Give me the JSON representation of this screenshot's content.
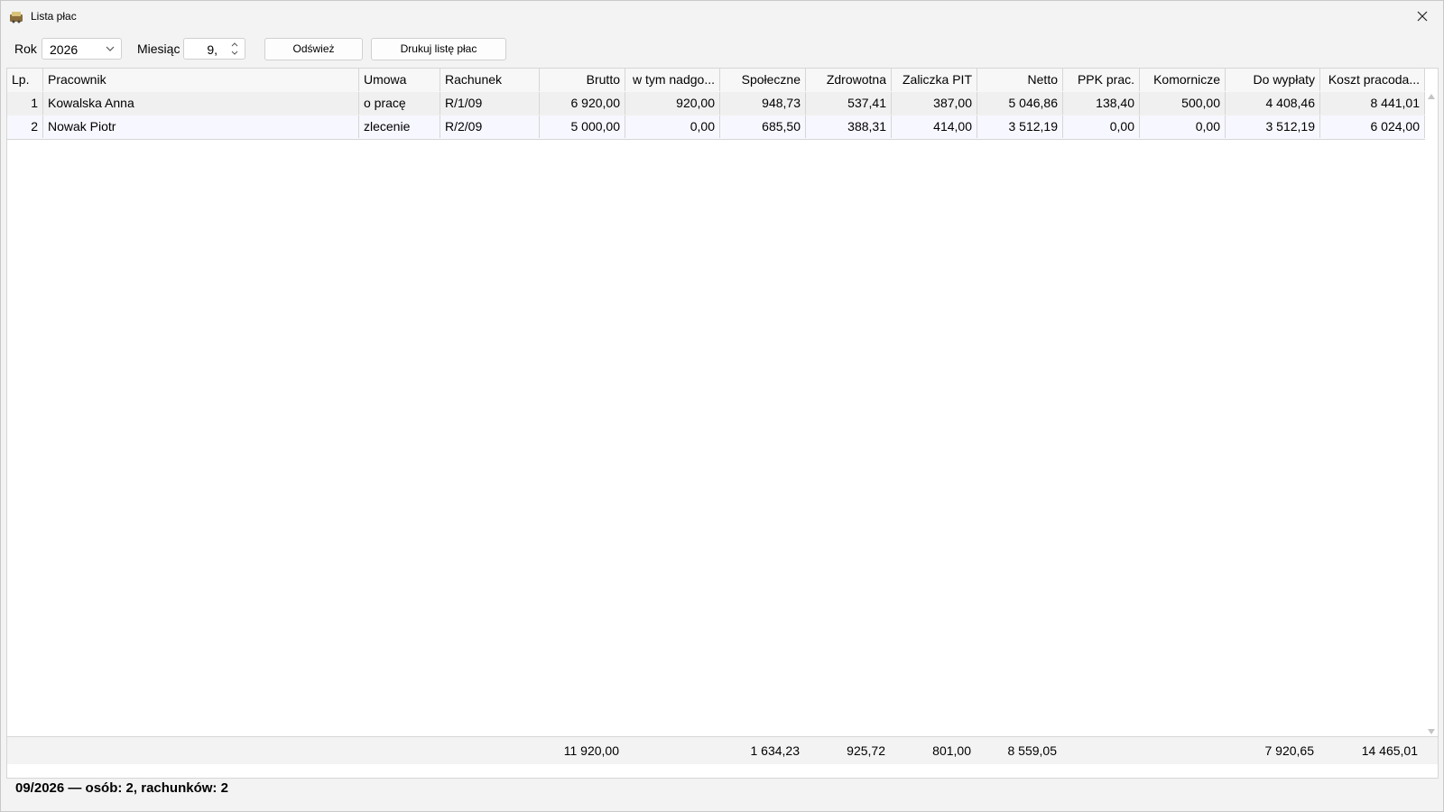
{
  "window": {
    "title": "Lista płac"
  },
  "toolbar": {
    "rok_label": "Rok",
    "rok_value": "2026",
    "miesiac_label": "Miesiąc",
    "miesiac_value": "9,",
    "refresh_label": "Odśwież",
    "print_label": "Drukuj listę płac"
  },
  "table": {
    "columns": [
      "Lp.",
      "Pracownik",
      "Umowa",
      "Rachunek",
      "Brutto",
      "w tym nadgo...",
      "Społeczne",
      "Zdrowotna",
      "Zaliczka PIT",
      "Netto",
      "PPK prac.",
      "Komornicze",
      "Do wypłaty",
      "Koszt pracoda..."
    ],
    "rows": [
      [
        "1",
        "Kowalska Anna",
        "o pracę",
        "R/1/09",
        "6 920,00",
        "920,00",
        "948,73",
        "537,41",
        "387,00",
        "5 046,86",
        "138,40",
        "500,00",
        "4 408,46",
        "8 441,01"
      ],
      [
        "2",
        "Nowak Piotr",
        "zlecenie",
        "R/2/09",
        "5 000,00",
        "0,00",
        "685,50",
        "388,31",
        "414,00",
        "3 512,19",
        "0,00",
        "0,00",
        "3 512,19",
        "6 024,00"
      ]
    ],
    "totals": {
      "brutto": "11 920,00",
      "spoleczne": "1 634,23",
      "zdrowotna": "925,72",
      "pit": "801,00",
      "netto": "8 559,05",
      "do_wyplaty": "7 920,65",
      "koszt": "14 465,01"
    }
  },
  "status": "09/2026 — osób: 2, rachunków: 2"
}
